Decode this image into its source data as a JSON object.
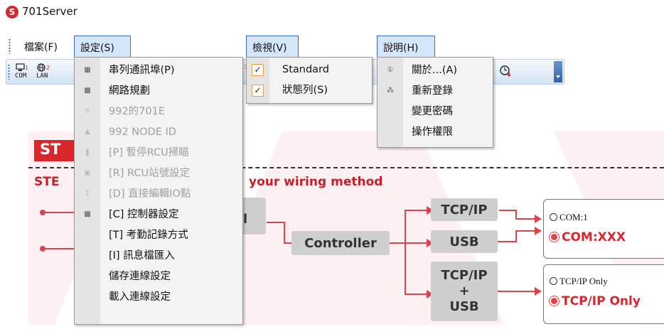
{
  "app": {
    "title": "701Server",
    "icon_letter": "S"
  },
  "menubar": {
    "file": "檔案(F)",
    "settings": "設定(S)",
    "view": "檢視(V)",
    "help": "說明(H)"
  },
  "toolbar": {
    "com_label": "COM",
    "com_index": "1",
    "lan_label": "LAN",
    "lan_index": "2",
    "hidden_index": "3"
  },
  "settings_menu": {
    "items": [
      {
        "label": "串列通訊埠(P)",
        "icon": "serial-port-icon",
        "enabled": true
      },
      {
        "label": "網路規劃",
        "icon": "network-icon",
        "enabled": true
      },
      {
        "label": "992的701E",
        "icon": "link-icon",
        "enabled": false
      },
      {
        "label": "992 NODE ID",
        "icon": "node-icon",
        "enabled": false
      },
      {
        "label": "[P] 暫停RCU掃瞄",
        "icon": "pause-scan-icon",
        "enabled": false
      },
      {
        "label": "[R] RCU站號設定",
        "icon": "station-icon",
        "enabled": false
      },
      {
        "label": "[D] 直接編輯IO點",
        "icon": "edit-io-icon",
        "enabled": false
      },
      {
        "label": "[C] 控制器設定",
        "icon": "controller-icon",
        "enabled": true
      },
      {
        "label": "[T] 考勤記錄方式",
        "icon": "",
        "enabled": true
      },
      {
        "label": "[I] 訊息檔匯入",
        "icon": "",
        "enabled": true
      },
      {
        "label": "儲存連線設定",
        "icon": "",
        "enabled": true
      },
      {
        "label": "載入連線設定",
        "icon": "",
        "enabled": true
      }
    ]
  },
  "view_menu": {
    "items": [
      {
        "label": "Standard",
        "checked": true
      },
      {
        "label": "狀態列(S)",
        "checked": true
      }
    ]
  },
  "help_menu": {
    "items": [
      {
        "label": "關於...(A)",
        "icon": "info-icon"
      },
      {
        "label": "重新登錄",
        "icon": "register-icon"
      },
      {
        "label": "變更密碼",
        "icon": ""
      },
      {
        "label": "操作權限",
        "icon": ""
      }
    ]
  },
  "banner": {
    "badge": "ST",
    "step_prefix": "STE",
    "step_rest": "your wiring method",
    "protocol_tail": "l",
    "controller": "Controller",
    "tcpip": "TCP/IP",
    "usb": "USB",
    "combo_line1": "TCP/IP",
    "combo_line2": "+",
    "combo_line3": "USB",
    "opt_com1": "COM:1",
    "opt_comxxx": "COM:XXX",
    "opt_tcpip_only": "TCP/IP Only",
    "opt_tcpip_only_selected": "TCP/IP Only"
  },
  "colors": {
    "accent_red": "#d9262c",
    "menu_highlight": "#d5e6fb",
    "toolbar_blue": "#3562a8"
  }
}
